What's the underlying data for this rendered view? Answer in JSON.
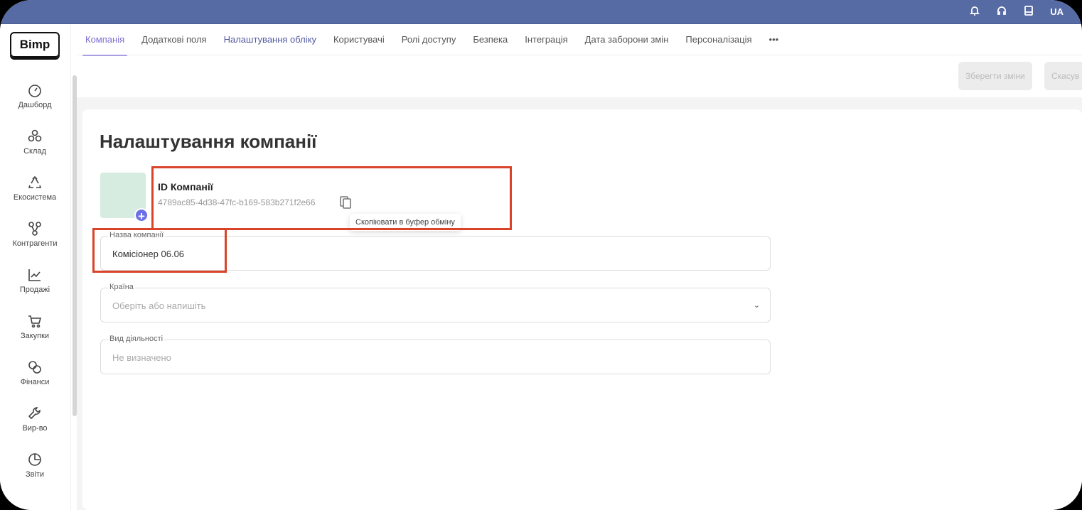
{
  "topbar": {
    "lang": "UA",
    "icons": [
      "bell-icon",
      "headset-icon",
      "book-icon"
    ]
  },
  "logo": "Bimp",
  "sidebar": {
    "items": [
      {
        "label": "Дашборд",
        "icon": "gauge-icon"
      },
      {
        "label": "Склад",
        "icon": "boxes-icon"
      },
      {
        "label": "Екосистема",
        "icon": "recycle-icon"
      },
      {
        "label": "Контрагенти",
        "icon": "network-icon"
      },
      {
        "label": "Продажі",
        "icon": "chart-line-icon"
      },
      {
        "label": "Закупки",
        "icon": "cart-icon"
      },
      {
        "label": "Фінанси",
        "icon": "coins-icon"
      },
      {
        "label": "Вир-во",
        "icon": "wrench-icon"
      },
      {
        "label": "Звіти",
        "icon": "pie-chart-icon"
      }
    ]
  },
  "tabs": [
    "Компанія",
    "Додаткові поля",
    "Налаштування обліку",
    "Користувачі",
    "Ролі доступу",
    "Безпека",
    "Інтеграція",
    "Дата заборони змін",
    "Персоналізація",
    "•••"
  ],
  "toolbar": {
    "save": "Зберегти зміни",
    "cancel": "Скасув"
  },
  "page": {
    "title": "Налаштування компанії",
    "id_label": "ID Компанії",
    "id_value": "4789ac85-4d38-47fc-b169-583b271f2e66",
    "tooltip": "Скопіювати в буфер обміну",
    "fields": [
      {
        "label": "Назва компанії",
        "value": "Комісіонер 06.06"
      },
      {
        "label": "Країна",
        "placeholder": "Оберіть або напишіть"
      },
      {
        "label": "Вид діяльності",
        "placeholder": "Не визначено"
      }
    ]
  },
  "colors": {
    "topbar": "#566aa3",
    "accent": "#7b6fd0",
    "highlight": "#d9432a"
  }
}
